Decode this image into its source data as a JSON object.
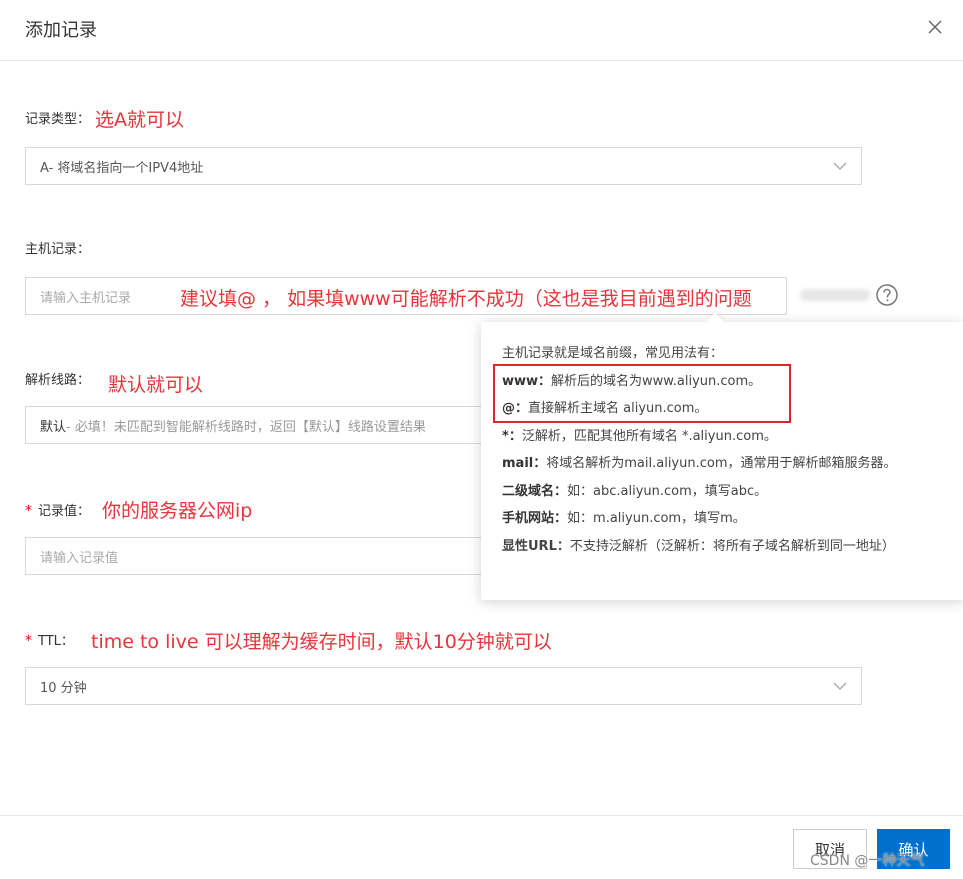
{
  "dialog": {
    "title": "添加记录"
  },
  "record_type": {
    "label": "记录类型",
    "colon": "：",
    "annotation": "选A就可以",
    "value": "A- 将域名指向一个IPV4地址"
  },
  "host_record": {
    "label": "主机记录：",
    "placeholder": "请输入主机记录",
    "annotation": "建议填@ ， 如果填www可能解析不成功（这也是我目前遇到的问题"
  },
  "tooltip": {
    "intro": "主机记录就是域名前缀，常见用法有：",
    "items": [
      {
        "key": "www",
        "sep": "：",
        "desc": "解析后的域名为www.aliyun.com。"
      },
      {
        "key": "@",
        "sep": "：",
        "desc": "直接解析主域名 aliyun.com。"
      },
      {
        "key": "*",
        "sep": "：",
        "desc": "泛解析，匹配其他所有域名 *.aliyun.com。"
      },
      {
        "key": "mail",
        "sep": "：",
        "desc": "将域名解析为mail.aliyun.com，通常用于解析邮箱服务器。"
      },
      {
        "key": "二级域名",
        "sep": "：",
        "desc": "如：abc.aliyun.com，填写abc。"
      },
      {
        "key": "手机网站",
        "sep": "：",
        "desc": "如：m.aliyun.com，填写m。"
      },
      {
        "key": "显性URL",
        "sep": "：",
        "desc": "不支持泛解析（泛解析：将所有子域名解析到同一地址）"
      }
    ]
  },
  "line": {
    "label": "解析线路",
    "colon": "：",
    "annotation": "默认就可以",
    "value_bold": "默认",
    "value_rest": " - 必填！未匹配到智能解析线路时，返回【默认】线路设置结果"
  },
  "record_value": {
    "required_mark": "*",
    "label": "记录值：",
    "annotation": "你的服务器公网ip",
    "placeholder": "请输入记录值"
  },
  "ttl": {
    "required_mark": "*",
    "label": "TTL：",
    "annotation": "time to live 可以理解为缓存时间，默认10分钟就可以",
    "value": "10 分钟"
  },
  "footer": {
    "cancel_label": "取消",
    "ok_label": "确认"
  },
  "watermark": "CSDN @一种天气",
  "colors": {
    "annotation_red": "#e8343a",
    "primary_blue": "#0070cc",
    "required_red": "#e60012"
  },
  "icons": [
    "close-icon",
    "chevron-down-icon",
    "help-icon"
  ]
}
